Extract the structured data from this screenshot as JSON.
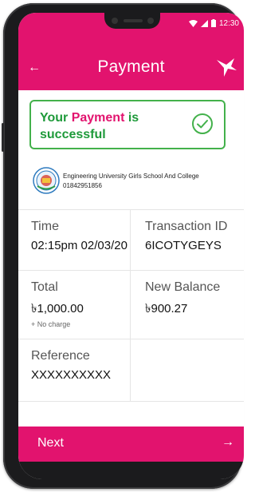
{
  "status_bar": {
    "time": "12:30"
  },
  "header": {
    "title": "Payment",
    "accent_color": "#e2136e"
  },
  "success_banner": {
    "prefix": "Your ",
    "highlight": "Payment",
    "suffix": " is successful",
    "icon": "check-circle-icon"
  },
  "merchant": {
    "name": "Engineering University Girls School And College",
    "phone": "01842951856"
  },
  "details": {
    "time_label": "Time",
    "time_value": "02:15pm 02/03/20",
    "txn_label": "Transaction ID",
    "txn_value": "6ICOTYGEYS",
    "total_label": "Total",
    "total_value": "৳1,000.00",
    "charge_note": "+ No charge",
    "balance_label": "New Balance",
    "balance_value": "৳900.27",
    "reference_label": "Reference",
    "reference_value": "XXXXXXXXXX"
  },
  "footer": {
    "next_label": "Next",
    "arrow": "→"
  },
  "nav": {
    "back_arrow": "←"
  }
}
